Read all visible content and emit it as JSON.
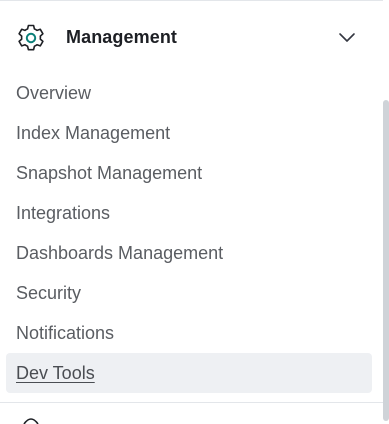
{
  "group": {
    "title": "Management",
    "icon": "gear-icon",
    "expand_icon": "chevron-down-icon"
  },
  "nav": {
    "items": [
      {
        "label": "Overview"
      },
      {
        "label": "Index Management"
      },
      {
        "label": "Snapshot Management"
      },
      {
        "label": "Integrations"
      },
      {
        "label": "Dashboards Management"
      },
      {
        "label": "Security"
      },
      {
        "label": "Notifications"
      },
      {
        "label": "Dev Tools"
      }
    ],
    "active_label": "Dev Tools"
  },
  "colors": {
    "accent": "#0b7f78",
    "active_bg": "#eef0f3",
    "text": "#5a5d62",
    "title": "#1d1f24"
  }
}
